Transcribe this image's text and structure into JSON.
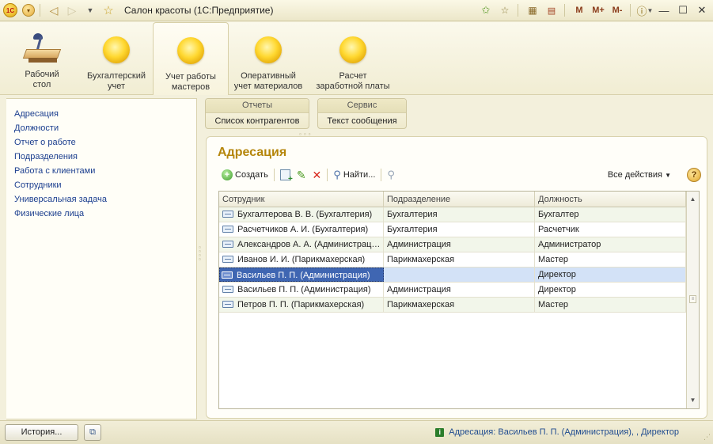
{
  "window": {
    "title": "Салон красоты  (1С:Предприятие)",
    "logo_text": "1С",
    "memory_buttons": [
      "M",
      "M+",
      "M-"
    ]
  },
  "sections": [
    {
      "label": "Рабочий\nстол",
      "line1": "Рабочий",
      "line2": "стол",
      "icon": "desk-icon"
    },
    {
      "label": "Бухгалтерский учет",
      "line1": "Бухгалтерский",
      "line2": "учет",
      "icon": "section-icon"
    },
    {
      "label": "Учет работы мастеров",
      "line1": "Учет работы",
      "line2": "мастеров",
      "icon": "section-icon",
      "active": true
    },
    {
      "label": "Оперативный учет материалов",
      "line1": "Оперативный",
      "line2": "учет материалов",
      "icon": "section-icon"
    },
    {
      "label": "Расчет заработной платы",
      "line1": "Расчет",
      "line2": "заработной платы",
      "icon": "section-icon"
    }
  ],
  "navigation": {
    "items": [
      "Адресация",
      "Должности",
      "Отчет о работе",
      "Подразделения",
      "Работа с клиентами",
      "Сотрудники",
      "Универсальная задача",
      "Физические лица"
    ]
  },
  "commands": {
    "groups": [
      {
        "title": "Отчеты",
        "item": "Список контрагентов"
      },
      {
        "title": "Сервис",
        "item": "Текст сообщения"
      }
    ]
  },
  "form": {
    "title": "Адресация",
    "toolbar": {
      "create_label": "Создать",
      "find_label": "Найти...",
      "all_actions_label": "Все действия",
      "help_label": "?"
    },
    "table": {
      "columns": [
        "Сотрудник",
        "Подразделение",
        "Должность"
      ],
      "rows": [
        {
          "employee": "Бухгалтерова В. В. (Бухгалтерия)",
          "department": "Бухгалтерия",
          "position": "Бухгалтер"
        },
        {
          "employee": "Расчетчиков А. И. (Бухгалтерия)",
          "department": "Бухгалтерия",
          "position": "Расчетчик"
        },
        {
          "employee": "Александров А. А. (Администрация)",
          "department": "Администрация",
          "position": "Администратор"
        },
        {
          "employee": "Иванов И. И. (Парикмахерская)",
          "department": "Парикмахерская",
          "position": "Мастер"
        },
        {
          "employee": "Васильев П. П. (Администрация)",
          "department": "",
          "position": "Директор",
          "selected": true
        },
        {
          "employee": "Васильев П. П. (Администрация)",
          "department": "Администрация",
          "position": "Директор"
        },
        {
          "employee": "Петров П. П. (Парикмахерская)",
          "department": "Парикмахерская",
          "position": "Мастер"
        }
      ]
    }
  },
  "statusbar": {
    "history_label": "История...",
    "info_text": "Адресация: Васильев П. П. (Администрация), , Директор"
  },
  "colors": {
    "accent_title": "#b5860c",
    "link": "#1c3f8f",
    "selection": "#3f66b2",
    "row_alt": "#f2f6ea"
  }
}
